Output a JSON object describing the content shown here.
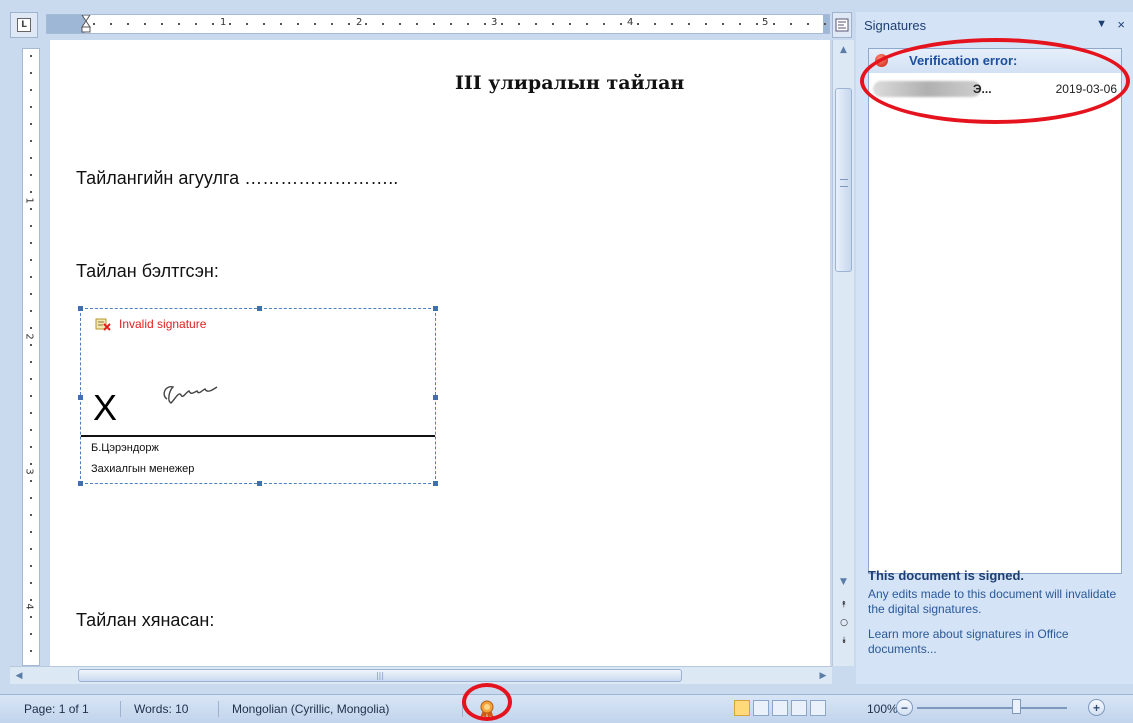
{
  "document": {
    "title": "III улиралын тайлан",
    "contents_line": "Тайлангийн агуулга ……………………..",
    "prepared_by": "Тайлан бэлтгсэн:",
    "reviewed_by": "Тайлан хянасан:"
  },
  "signature_line": {
    "status": "Invalid signature",
    "x_mark": "X",
    "signer_name": "Б.Цэрэндорж",
    "signer_title": "Захиалгын менежер"
  },
  "ruler": {
    "numbers": [
      "1",
      "2",
      "3",
      "4",
      "5"
    ]
  },
  "pane": {
    "title": "Signatures",
    "menu_glyph": "▼",
    "close_glyph": "×",
    "error_header": "Verification error:",
    "signature_entry": {
      "name_suffix": "Э...",
      "date": "2019-03-06"
    },
    "signed_title": "This document is signed.",
    "signed_desc": "Any edits made to this document will invalidate the digital signatures.",
    "learn_more": "Learn more about signatures in Office documents..."
  },
  "status_bar": {
    "page": "Page: 1 of 1",
    "words": "Words: 10",
    "language": "Mongolian (Cyrillic, Mongolia)",
    "zoom": "100%",
    "zoom_minus": "−",
    "zoom_plus": "+"
  },
  "colors": {
    "error_red": "#e02020",
    "annotation_red": "#e5131d",
    "pane_blue": "#d4e3f5"
  }
}
